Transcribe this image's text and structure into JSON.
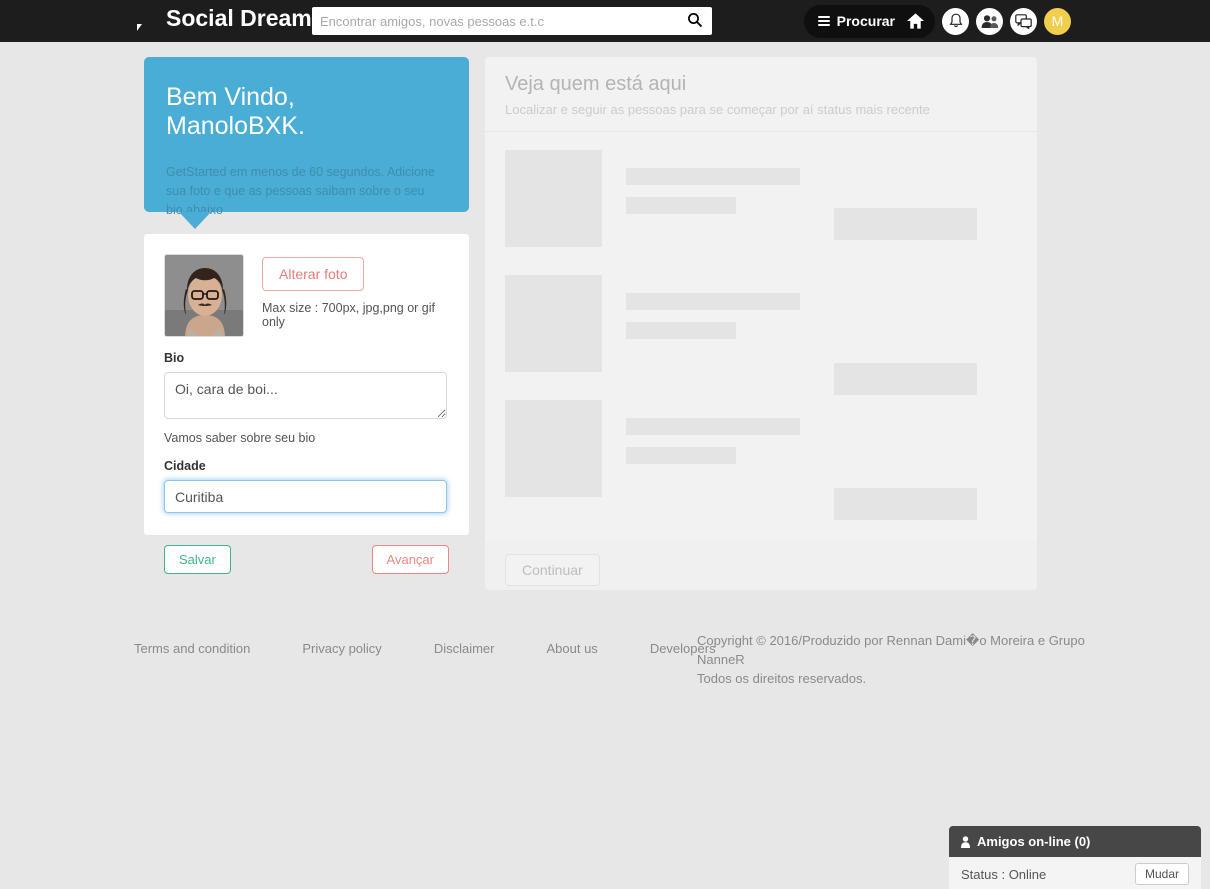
{
  "header": {
    "brand": "Social Dream",
    "brand_icon": "speech-bubble-icon",
    "search_placeholder": "Encontrar amigos, novas pessoas e.t.c",
    "search_value": "",
    "search_icon": "search-icon",
    "procurar_label": "Procurar",
    "menu_icon": "hamburger-icon",
    "icons": [
      {
        "name": "home-icon"
      },
      {
        "name": "bell-icon"
      },
      {
        "name": "friends-icon"
      },
      {
        "name": "messages-icon"
      }
    ],
    "avatar_initial": "M",
    "avatar_color": "#f0cf4f",
    "background": "#1d1d1d"
  },
  "welcome": {
    "title": "Bem Vindo, ManoloBXK.",
    "body": "GetStarted em menos de 60 segundos. Adicione sua foto e que as pessoas saibam sobre o seu bio abaixo",
    "color": "#4aadd6"
  },
  "profile_form": {
    "change_photo_label": "Alterar foto",
    "photo_hint": "Max size : 700px, jpg,png or gif only",
    "bio_label": "Bio",
    "bio_value": "Oi, cara de boi...",
    "bio_help": "Vamos saber sobre seu bio",
    "city_label": "Cidade",
    "city_value": "Curitiba",
    "save_label": "Salvar",
    "next_label": "Avançar",
    "save_color": "#3fb58b",
    "next_color": "#ef8683"
  },
  "right_panel": {
    "title": "Veja quem está aqui",
    "subtitle": "Localizar e seguir as pessoas para se começar por aí status mais recente",
    "continue_label": "Continuar",
    "skeleton_rows": 3,
    "disabled": true
  },
  "footer": {
    "links": [
      "Terms and condition",
      "Privacy policy",
      "Disclaimer",
      "About us",
      "Developers"
    ],
    "copyright_line1": "Copyright © 2016/Produzido por Rennan Dami�o Moreira e Grupo NanneR",
    "copyright_line2": "Todos os direitos reservados."
  },
  "chat_widget": {
    "title": "Amigos on-line (0)",
    "person_icon": "person-icon",
    "status": "Status : Online",
    "change_label": "Mudar"
  }
}
